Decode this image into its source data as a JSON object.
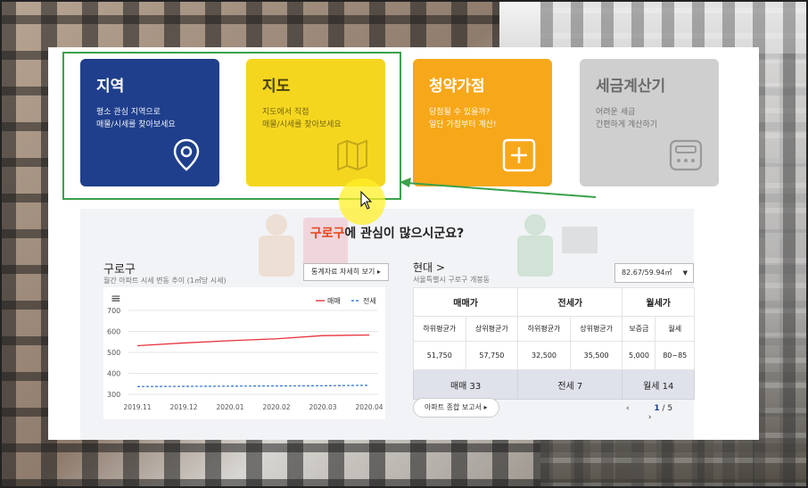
{
  "cards": [
    {
      "title": "지역",
      "desc1": "평소 관심 지역으로",
      "desc2": "매물/시세를 찾아보세요",
      "icon": "map-pin-icon"
    },
    {
      "title": "지도",
      "desc1": "지도에서 직접",
      "desc2": "매물/시세를 찾아보세요",
      "icon": "folded-map-icon"
    },
    {
      "title": "청약가점",
      "desc1": "당첨될 수 있을까?",
      "desc2": "일단 가점부터 계산!",
      "icon": "plus-square-icon"
    },
    {
      "title": "세금계산기",
      "desc1": "어려운 세금",
      "desc2": "간편하게 계산하기",
      "icon": "calculator-icon"
    }
  ],
  "headline": {
    "highlight": "구로구",
    "rest": "에 관심이 많으시군요?"
  },
  "gu_panel": {
    "title": "구로구",
    "subtitle": "월간 아파트 시세 변동 추이 (1㎡당 시세)",
    "detail_button": "통계자료 자세히 보기 ▸",
    "menu_glyph": "≡"
  },
  "chart_data": {
    "type": "line",
    "x": [
      "2019.11",
      "2019.12",
      "2020.01",
      "2020.02",
      "2020.03",
      "2020.04"
    ],
    "series": [
      {
        "name": "매매",
        "values": [
          532,
          545,
          556,
          565,
          580,
          583
        ],
        "color": "#e8323c",
        "style": "solid"
      },
      {
        "name": "전세",
        "values": [
          337,
          338,
          339,
          340,
          341,
          343
        ],
        "color": "#3a7bd5",
        "style": "dashed"
      }
    ],
    "y_ticks": [
      300,
      400,
      500,
      600,
      700
    ],
    "ylim": [
      300,
      700
    ],
    "legend_position": "top-right",
    "grid": true
  },
  "apt_panel": {
    "title": "현대 >",
    "subtitle": "서울특별시 구로구 개봉동",
    "area_select": "82.67/59.94㎡",
    "headers": [
      "매매가",
      "전세가",
      "월세가"
    ],
    "subheaders": [
      "하위평균가",
      "상위평균가",
      "하위평균가",
      "상위평균가",
      "보증금",
      "월세"
    ],
    "values": [
      "51,750",
      "57,750",
      "32,500",
      "35,500",
      "5,000",
      "80~85"
    ],
    "counts": [
      "매매 33",
      "전세 7",
      "월세 14"
    ],
    "report_button": "아파트 종합 보고서 ▸",
    "pager": {
      "prev": "‹",
      "current": "1",
      "sep": "/",
      "total": "5",
      "next": "›"
    }
  },
  "colors": {
    "region": "#1f3f8c",
    "map": "#f5d61f",
    "subscription": "#f7a71a",
    "tax": "#cfcfcf",
    "annotation": "#3aa14b",
    "highlight": "#e8431a"
  }
}
